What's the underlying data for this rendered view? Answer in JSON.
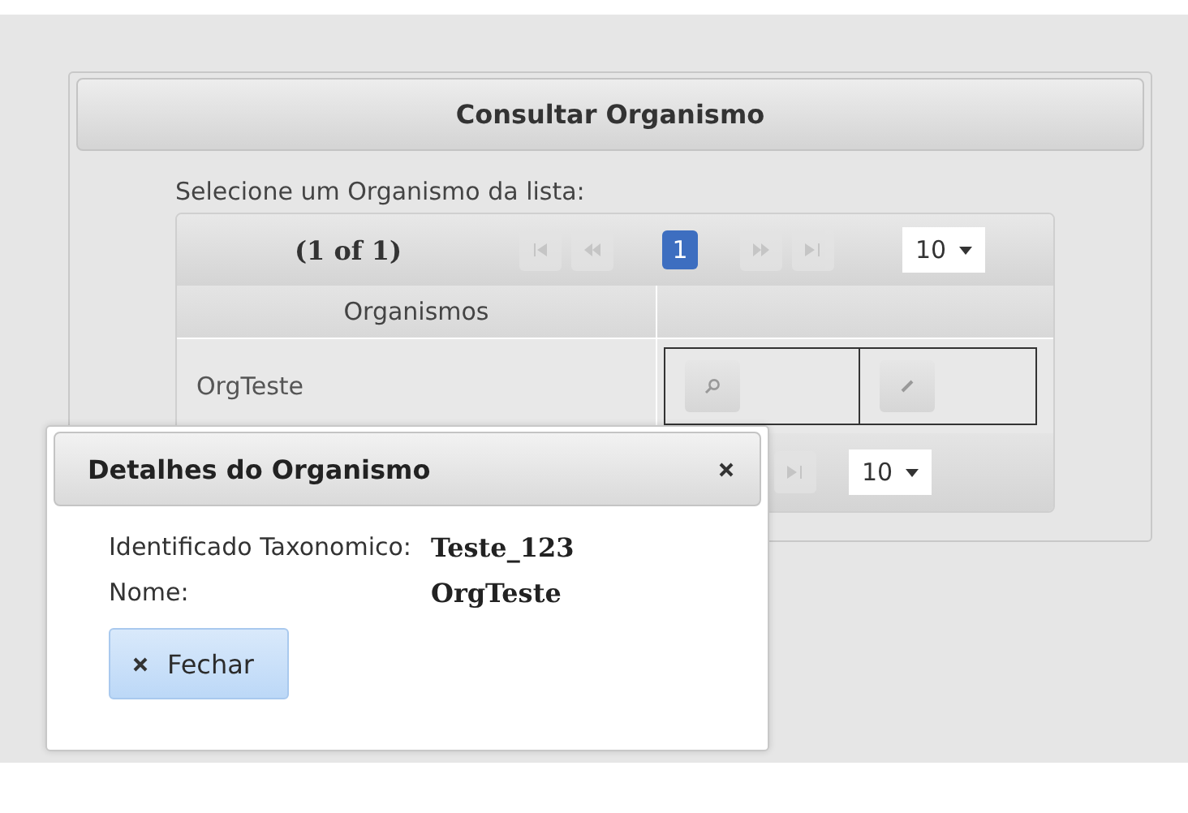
{
  "panel": {
    "title": "Consultar Organismo",
    "prompt": "Selecione um Organismo da lista:",
    "table": {
      "paginator_top": {
        "report": "(1 of 1)",
        "pages": [
          {
            "label": "1",
            "selected": true
          }
        ],
        "rows_per_page": "10"
      },
      "columns": [
        "Organismos"
      ],
      "rows": [
        {
          "organismo": "OrgTeste"
        }
      ],
      "paginator_bottom": {
        "rows_per_page": "10"
      }
    }
  },
  "dialog": {
    "title": "Detalhes do Organismo",
    "fields": [
      {
        "label": "Identificado Taxonomico:",
        "value": "Teste_123"
      },
      {
        "label": "Nome:",
        "value": "OrgTeste"
      }
    ],
    "button": "Fechar"
  }
}
